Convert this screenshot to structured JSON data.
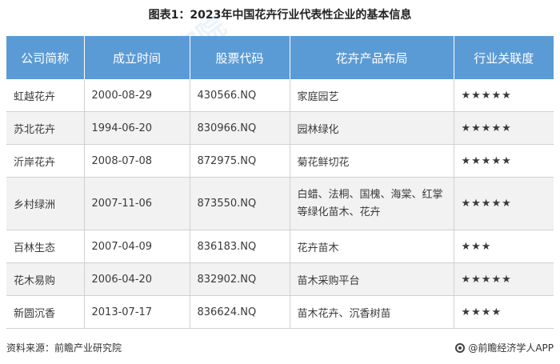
{
  "title": "图表1：2023年中国花卉行业代表性企业的基本信息",
  "table": {
    "headers": [
      "公司简称",
      "成立时间",
      "股票代码",
      "花卉产品布局",
      "行业关联度"
    ],
    "rows": [
      {
        "name": "虹越花卉",
        "date": "2000-08-29",
        "code": "430566.NQ",
        "products": "家庭园艺",
        "relevance": "★★★★★"
      },
      {
        "name": "苏北花卉",
        "date": "1994-06-20",
        "code": "830966.NQ",
        "products": "园林绿化",
        "relevance": "★★★★★"
      },
      {
        "name": "沂岸花卉",
        "date": "2008-07-08",
        "code": "872975.NQ",
        "products": "菊花鲜切花",
        "relevance": "★★★★★"
      },
      {
        "name": "乡村绿洲",
        "date": "2007-11-06",
        "code": "873550.NQ",
        "products": "白蜡、法桐、国槐、海棠、红掌等绿化苗木、花卉",
        "relevance": "★★★★★"
      },
      {
        "name": "百林生态",
        "date": "2007-04-09",
        "code": "836183.NQ",
        "products": "花卉苗木",
        "relevance": "★★★"
      },
      {
        "name": "花木易购",
        "date": "2006-04-20",
        "code": "832902.NQ",
        "products": "苗木采购平台",
        "relevance": "★★★★★"
      },
      {
        "name": "新圆沉香",
        "date": "2013-07-17",
        "code": "836624.NQ",
        "products": "苗木花卉、沉香树苗",
        "relevance": "★★★★"
      }
    ]
  },
  "footer": {
    "source": "资料来源：前瞻产业研究院",
    "brand": "@前瞻经济学人APP"
  },
  "watermark": {
    "text": "前瞻产业研究院"
  },
  "colors": {
    "header_bg": "#5b9bd5",
    "row_alt": "#f2f2f2"
  }
}
